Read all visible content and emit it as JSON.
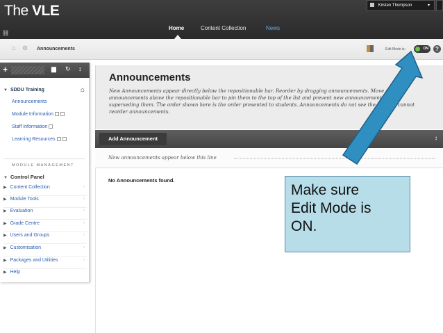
{
  "header": {
    "brand_the": "The ",
    "brand_vle": "VLE",
    "user_name": "Kirsten Thompson",
    "user_chevron": "▾",
    "nav": {
      "home": "Home",
      "content_collection": "Content Collection",
      "news": "News"
    }
  },
  "breadcrumb": {
    "current": "Announcements",
    "edit_mode_label": "Edit Mode is:",
    "toggle_state": "ON",
    "help": "?"
  },
  "sidebar": {
    "toolbar": {
      "add": "+",
      "folder": "▆",
      "refresh": "↻",
      "sort": "↕"
    },
    "course_title": "SDDU Training",
    "links": [
      "Announcements",
      "Module Information",
      "Staff Information",
      "Learning Resources"
    ],
    "section_label": "MODULE MANAGEMENT",
    "control_panel": "Control Panel",
    "control_panel_items": [
      "Content Collection",
      "Module Tools",
      "Evaluation",
      "Grade Centre",
      "Users and Groups",
      "Customisation",
      "Packages and Utilities",
      "Help"
    ]
  },
  "main": {
    "title": "Announcements",
    "description": "New Announcements appear directly below the repositionable bar. Reorder by dragging announcements. Move priority announcements above the repositionable bar to pin them to the top of the list and prevent new announcements from superseding them. The order shown here is the order presented to students. Announcements do not see the bar and cannot reorder announcements.",
    "add_button": "Add Announcement",
    "sort_icon": "↕",
    "repositionable_text": "New announcements appear below this line",
    "empty_message": "No Announcements found."
  },
  "callout": {
    "line1": "Make sure",
    "line2": "Edit Mode is",
    "line3": "ON."
  },
  "colors": {
    "callout_bg": "#b7dde8",
    "arrow": "#2f8fc0",
    "toggle_on": "#6ec24a",
    "link": "#2a5db0"
  }
}
